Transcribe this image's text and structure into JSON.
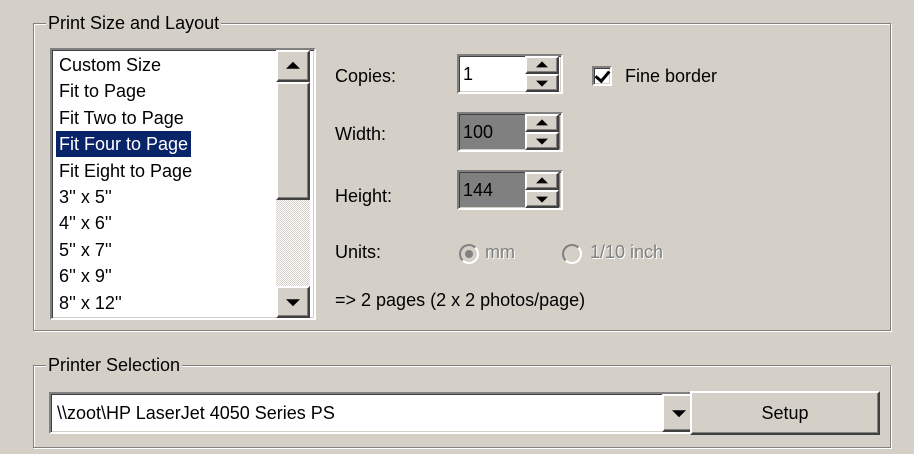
{
  "print_size_group": {
    "title": "Print Size and Layout",
    "size_list": {
      "items": [
        {
          "label": "Custom Size"
        },
        {
          "label": "Fit to Page"
        },
        {
          "label": "Fit Two to Page"
        },
        {
          "label": "Fit Four to Page",
          "selected": true
        },
        {
          "label": "Fit Eight to Page"
        },
        {
          "label": "3'' x 5''"
        },
        {
          "label": "4'' x 6''"
        },
        {
          "label": "5'' x 7''"
        },
        {
          "label": "6'' x 9''"
        },
        {
          "label": "8'' x 12''"
        }
      ],
      "selected_index": 3
    },
    "copies": {
      "label": "Copies:",
      "value": "1"
    },
    "fine_border": {
      "label": "Fine border",
      "checked": true
    },
    "width": {
      "label": "Width:",
      "value": "100"
    },
    "height": {
      "label": "Height:",
      "value": "144"
    },
    "units": {
      "label": "Units:",
      "options": [
        "mm",
        "1/10 inch"
      ],
      "selected": "mm",
      "enabled": false
    },
    "summary": "=> 2 pages (2 x 2 photos/page)"
  },
  "printer_group": {
    "title": "Printer Selection",
    "printer": {
      "value": "\\\\zoot\\HP LaserJet 4050 Series PS"
    },
    "setup_label": "Setup"
  },
  "colors": {
    "face": "#d4d0c8",
    "selection": "#0a246a",
    "disabled_field": "#808080"
  }
}
